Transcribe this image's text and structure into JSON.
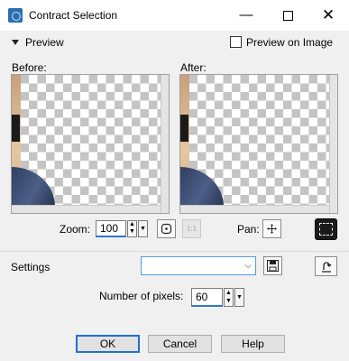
{
  "window": {
    "title": "Contract Selection",
    "minimize_icon": "minimize-icon",
    "maximize_icon": "maximize-icon",
    "close_icon": "close-icon",
    "minimize_glyph": "—",
    "close_glyph": "✕"
  },
  "preview": {
    "label": "Preview",
    "preview_on_image_label": "Preview on Image",
    "preview_on_image_checked": false
  },
  "panels": {
    "before_label": "Before:",
    "after_label": "After:"
  },
  "zoom": {
    "label": "Zoom:",
    "value": "100",
    "pan_label": "Pan:",
    "actual_size_glyph": "1:1"
  },
  "settings": {
    "label": "Settings",
    "value": ""
  },
  "pixels": {
    "label": "Number of pixels:",
    "value": "60"
  },
  "buttons": {
    "ok": "OK",
    "cancel": "Cancel",
    "help": "Help"
  }
}
